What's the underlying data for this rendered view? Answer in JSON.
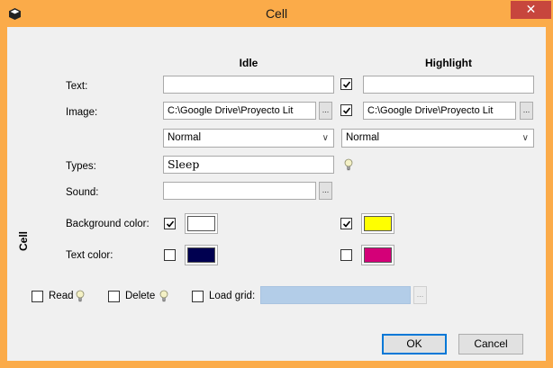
{
  "window": {
    "title": "Cell",
    "close_glyph": "✕",
    "icon": "cube-icon",
    "colors": {
      "titlebar": "#fbab49",
      "close": "#c7463d",
      "client": "#f0f0f0"
    }
  },
  "columns": {
    "idle": "Idle",
    "highlight": "Highlight"
  },
  "labels": {
    "text": "Text:",
    "image": "Image:",
    "types": "Types:",
    "sound": "Sound:",
    "background_color": "Background color:",
    "text_color": "Text color:",
    "group": "Cell"
  },
  "idle": {
    "text_value": "",
    "image_value": "C:\\Google Drive\\Proyecto Lit",
    "image_browse": "...",
    "mode_selected": "Normal",
    "types_value": "Sleep",
    "sound_value": "",
    "sound_browse": "...",
    "background_enabled": true,
    "background_color": "#ffffff",
    "text_color_enabled": false,
    "text_color": "#000050"
  },
  "highlight": {
    "text_enabled": true,
    "text_value": "",
    "image_enabled": true,
    "image_value": "C:\\Google Drive\\Proyecto Lit",
    "image_browse": "...",
    "mode_selected": "Normal",
    "background_enabled": true,
    "background_color": "#ffff00",
    "text_color_enabled": false,
    "text_color": "#d40078"
  },
  "options": {
    "read_label": "Read",
    "read_checked": false,
    "delete_label": "Delete",
    "delete_checked": false,
    "load_grid_label": "Load grid:",
    "load_grid_checked": false,
    "load_grid_value": "",
    "load_grid_browse": "..."
  },
  "buttons": {
    "ok": "OK",
    "cancel": "Cancel"
  },
  "icons": [
    "cube-icon",
    "close-icon",
    "lightbulb-icon",
    "chevron-down-icon",
    "checkmark-icon"
  ]
}
